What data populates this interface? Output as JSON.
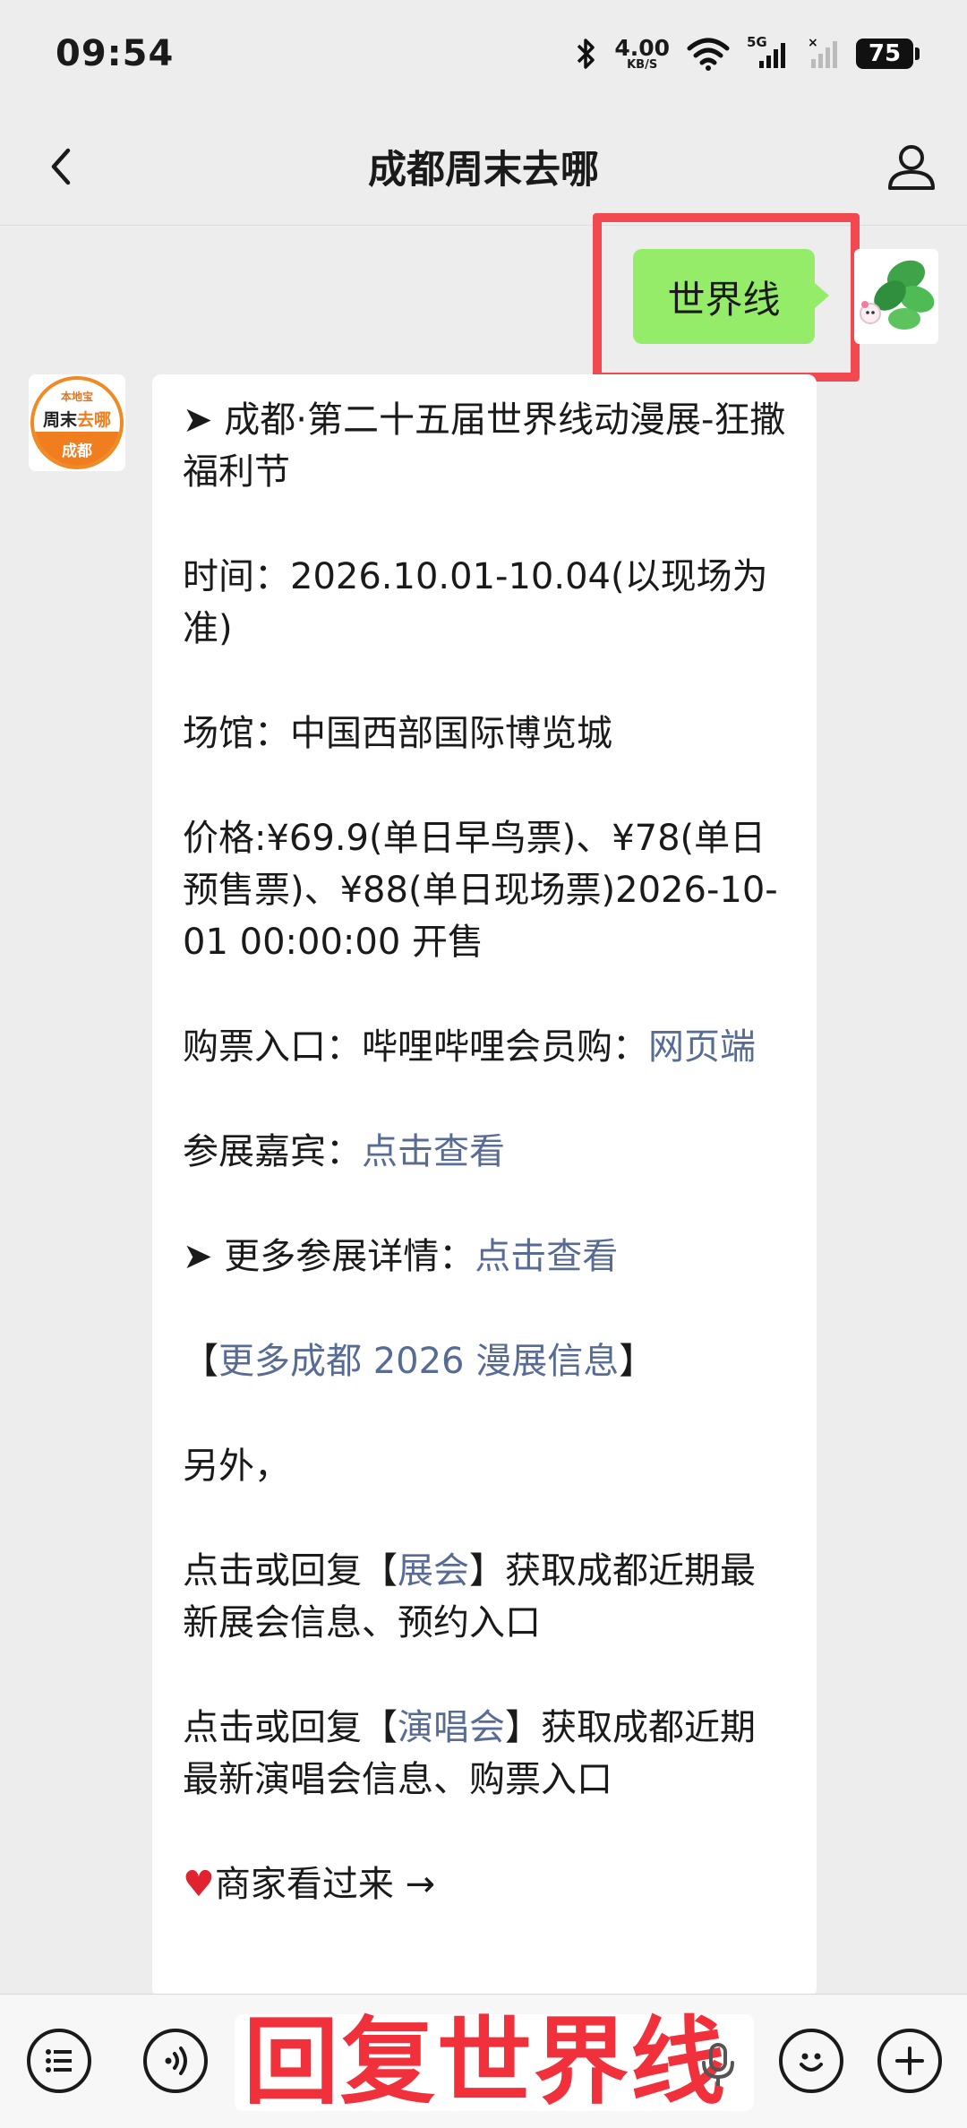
{
  "status_bar": {
    "time": "09:54",
    "net_speed": "4.00",
    "net_speed_unit": "KB/S",
    "network": "5G",
    "battery": "75"
  },
  "header": {
    "title": "成都周末去哪",
    "back_icon": "chevron-left-icon",
    "profile_icon": "person-icon"
  },
  "chat": {
    "outgoing_message": "世界线",
    "bot_logo": {
      "top": "本地宝",
      "mid_a": "周末",
      "mid_b": "去哪",
      "bottom": "成都"
    },
    "reply": {
      "title": "➤ 成都·第二十五届世界线动漫展-狂撒福利节",
      "time": "时间：2026.10.01-10.04(以现场为准)",
      "venue": "场馆：中国西部国际博览城",
      "price": "价格:¥69.9(单日早鸟票)、¥78(单日预售票)、¥88(单日现场票)2026-10-01 00:00:00 开售",
      "ticket_prefix": "购票入口：哔哩哔哩会员购：",
      "ticket_link": "网页端",
      "guest_prefix": "参展嘉宾：",
      "guest_link": "点击查看",
      "more_prefix": "➤ 更多参展详情：",
      "more_link": "点击查看",
      "more_info_open": "【",
      "more_info_link": "更多成都 2026 漫展信息",
      "more_info_close": "】",
      "besides": "另外，",
      "expo_prefix": "点击或回复【",
      "expo_link": "展会",
      "expo_suffix": "】获取成都近期最新展会信息、预约入口",
      "concert_prefix": "点击或回复【",
      "concert_link": "演唱会",
      "concert_suffix": "】获取成都近期最新演唱会信息、购票入口",
      "merchant_heart": "♥",
      "merchant": "商家看过来 →"
    }
  },
  "input_bar": {
    "text": "回复世界线",
    "menu_icon": "list-menu-icon",
    "voice_icon": "voice-icon",
    "mic_icon": "microphone-icon",
    "emoji_icon": "emoji-icon",
    "plus_icon": "plus-icon"
  },
  "colors": {
    "outgoing_bubble": "#95ec69",
    "link": "#576b95",
    "highlight": "#f2484f",
    "input_text": "#f0313b"
  }
}
